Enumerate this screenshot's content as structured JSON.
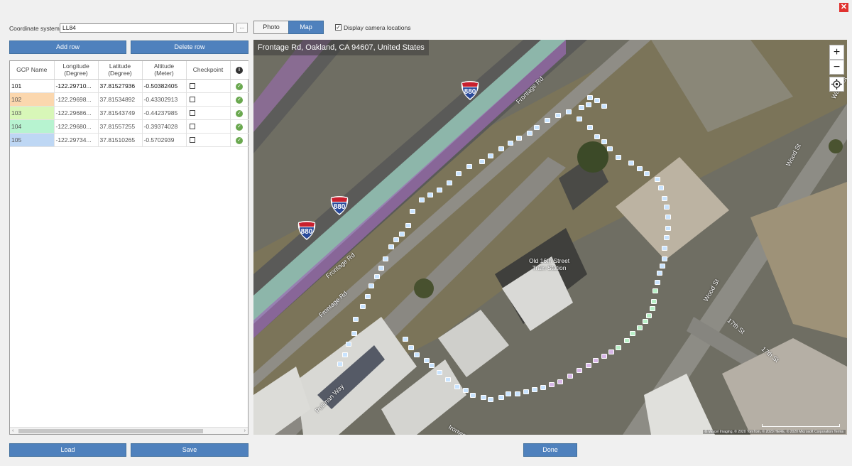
{
  "window": {
    "close_icon": "close-icon"
  },
  "coord_system": {
    "label": "Coordinate system:",
    "value": "LL84",
    "more_label": "..."
  },
  "buttons": {
    "add_row": "Add row",
    "delete_row": "Delete row",
    "load": "Load",
    "save": "Save",
    "done": "Done"
  },
  "table": {
    "headers": [
      "GCP Name",
      "Longitude (Degree)",
      "Latitude (Degree)",
      "Altitude (Meter)",
      "Checkpoint"
    ],
    "info_icon": "i",
    "rows": [
      {
        "name": "101",
        "lon": "-122.29710...",
        "lat": "37.81527936",
        "alt": "-0.50382405",
        "color": "#ffffff"
      },
      {
        "name": "102",
        "lon": "-122.29698...",
        "lat": "37.81534892",
        "alt": "-0.43302913",
        "color": "#fbd7ae"
      },
      {
        "name": "103",
        "lon": "-122.29686...",
        "lat": "37.81543749",
        "alt": "-0.44237985",
        "color": "#d8f7b8"
      },
      {
        "name": "104",
        "lon": "-122.29680...",
        "lat": "37.81557255",
        "alt": "-0.39374028",
        "color": "#b7f3d0"
      },
      {
        "name": "105",
        "lon": "-122.29734...",
        "lat": "37.81510265",
        "alt": "-0.5702939",
        "color": "#bed7f4"
      }
    ]
  },
  "view_tabs": {
    "photo": "Photo",
    "map": "Map",
    "active": "Map"
  },
  "display_camera": {
    "label": "Display camera locations",
    "checked": true
  },
  "map": {
    "address": "Frontage Rd, Oakland, CA 94607, United States",
    "zoom_in": "+",
    "zoom_out": "−",
    "locate_icon": "crosshair-icon",
    "shield_number": "880",
    "street_labels": [
      "Frontage Rd",
      "Frontage Rd",
      "Frontage Rd",
      "Wood St",
      "Wood St",
      "Wood St",
      "17th St",
      "17th St",
      "Pullman Way",
      "Ironwood Rd"
    ],
    "poi_label_1": "Old 16th Street",
    "poi_label_2": "Train Station",
    "attribution": "© Vexcel Imaging, © 2020 TomTom, © 2020 HERE, © 2020 Microsoft Corporation Terms"
  },
  "colors": {
    "accent": "#4f81bd",
    "close": "#e0322f",
    "ok": "#6aa84f",
    "highway_teal": "#9fd6c5",
    "highway_purple": "#9b6bb3"
  }
}
